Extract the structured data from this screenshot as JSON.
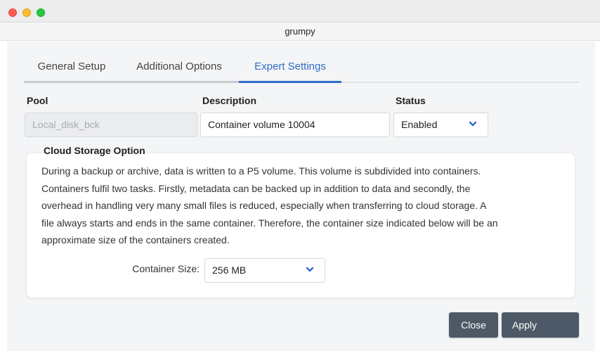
{
  "window": {
    "title": "grumpy"
  },
  "tabs": [
    {
      "label": "General Setup",
      "active": false
    },
    {
      "label": "Additional Options",
      "active": false
    },
    {
      "label": "Expert Settings",
      "active": true
    }
  ],
  "fields": {
    "pool": {
      "label": "Pool",
      "value": "Local_disk_bck",
      "disabled": true
    },
    "description": {
      "label": "Description",
      "value": "Container volume 10004"
    },
    "status": {
      "label": "Status",
      "value": "Enabled",
      "icon": "chevron-down-icon"
    }
  },
  "cloud_storage": {
    "title": "Cloud Storage Option",
    "description_lines": [
      "During a backup or archive, data is written to a P5 volume. This volume is subdivided into containers.",
      "Containers fulfil two tasks. Firstly, metadata can be backed up in addition to data and secondly, the",
      "overhead in handling very many small files is reduced, especially when transferring to cloud storage. A",
      "file always starts and ends in the same container. Therefore, the container size indicated below will be an",
      "approximate size of the containers created."
    ],
    "container_size": {
      "label": "Container Size:",
      "value": "256 MB",
      "icon": "chevron-down-icon"
    }
  },
  "buttons": {
    "close": "Close",
    "apply": "Apply"
  },
  "colors": {
    "accent": "#2f6dc7",
    "button": "#4d5966"
  }
}
